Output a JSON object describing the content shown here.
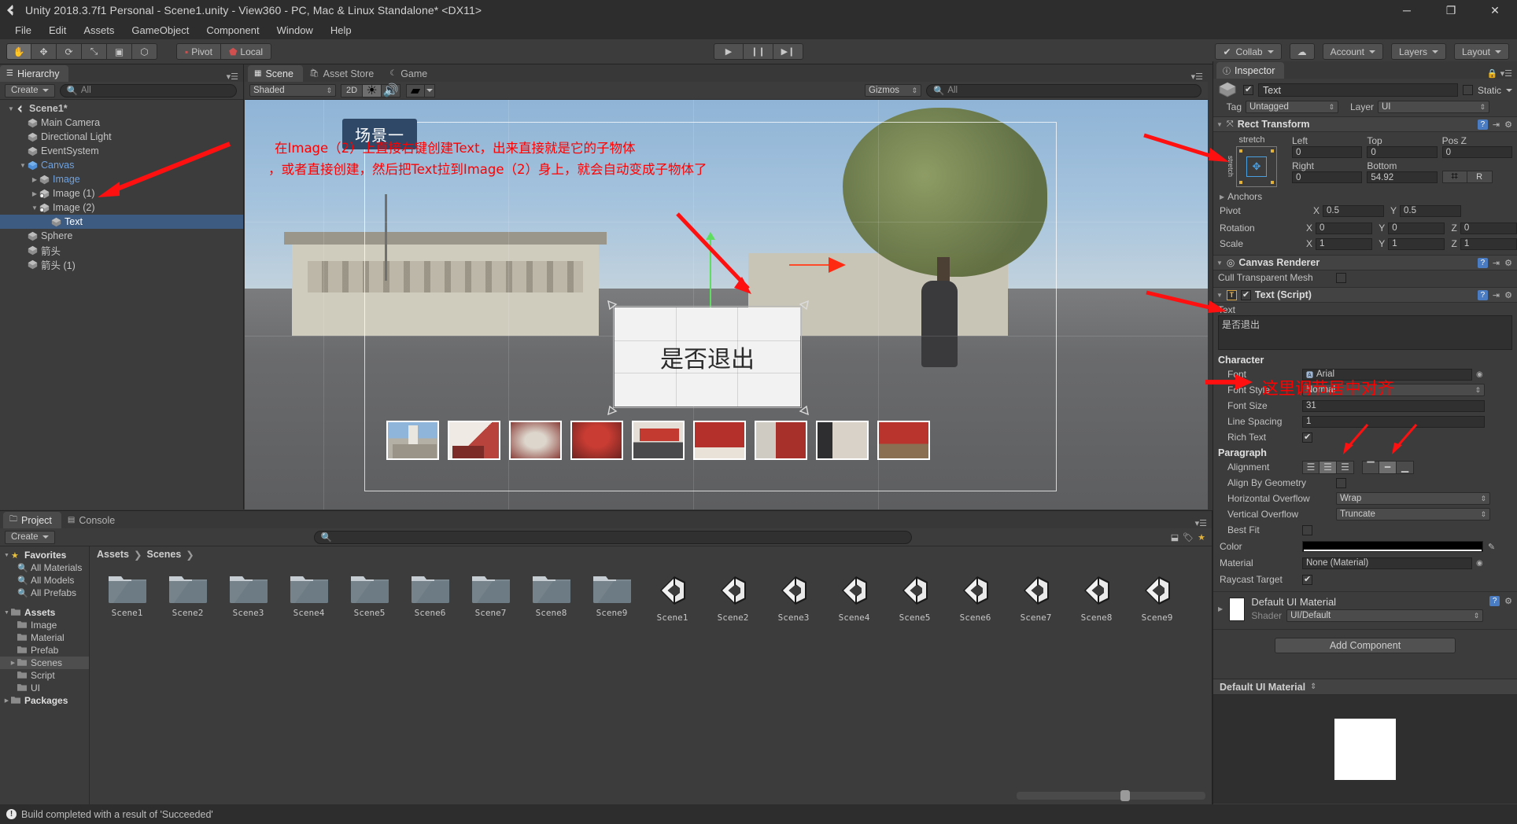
{
  "window": {
    "title": "Unity 2018.3.7f1 Personal - Scene1.unity - View360 - PC, Mac & Linux Standalone* <DX11>",
    "minimize": "─",
    "maximize": "❐",
    "close": "✕"
  },
  "menu": {
    "items": [
      "File",
      "Edit",
      "Assets",
      "GameObject",
      "Component",
      "Window",
      "Help"
    ]
  },
  "toolbar": {
    "tools": [
      "hand-tool",
      "move-tool",
      "rotate-tool",
      "scale-tool",
      "rect-tool",
      "transform-tool"
    ],
    "pivot_label": "Pivot",
    "local_label": "Local",
    "play": "▶",
    "pause": "❙❙",
    "step": "▶❙",
    "collab": "Collab",
    "cloud": "cloud-icon",
    "account": "Account",
    "layers": "Layers",
    "layout": "Layout"
  },
  "hierarchy": {
    "tab": "Hierarchy",
    "create": "Create",
    "search_placeholder": "All",
    "items": [
      {
        "label": "Scene1*",
        "depth": 0,
        "icon": "unity-scene-icon",
        "arrow": "down",
        "selected": false,
        "bold": true
      },
      {
        "label": "Main Camera",
        "depth": 1,
        "icon": "cube-icon",
        "arrow": "none",
        "selected": false,
        "bold": false
      },
      {
        "label": "Directional Light",
        "depth": 1,
        "icon": "cube-icon",
        "arrow": "none",
        "selected": false,
        "bold": false
      },
      {
        "label": "EventSystem",
        "depth": 1,
        "icon": "cube-icon",
        "arrow": "none",
        "selected": false,
        "bold": false
      },
      {
        "label": "Canvas",
        "depth": 1,
        "icon": "canvas-icon",
        "arrow": "down",
        "selected": false,
        "bold": false,
        "blue": true
      },
      {
        "label": "Image",
        "depth": 2,
        "icon": "cube-icon",
        "arrow": "right",
        "selected": false,
        "bold": false,
        "blue": true
      },
      {
        "label": "Image (1)",
        "depth": 2,
        "icon": "prefab-icon",
        "arrow": "right",
        "selected": false,
        "bold": false
      },
      {
        "label": "Image (2)",
        "depth": 2,
        "icon": "prefab-icon",
        "arrow": "down",
        "selected": false,
        "bold": false
      },
      {
        "label": "Text",
        "depth": 3,
        "icon": "cube-icon",
        "arrow": "none",
        "selected": true,
        "bold": false
      },
      {
        "label": "Sphere",
        "depth": 1,
        "icon": "cube-icon",
        "arrow": "none",
        "selected": false,
        "bold": false
      },
      {
        "label": "箭头",
        "depth": 1,
        "icon": "cube-icon",
        "arrow": "none",
        "selected": false,
        "bold": false
      },
      {
        "label": "箭头 (1)",
        "depth": 1,
        "icon": "cube-icon",
        "arrow": "none",
        "selected": false,
        "bold": false
      }
    ]
  },
  "scene": {
    "tabs": [
      {
        "label": "Scene",
        "icon": "grid-icon",
        "active": true
      },
      {
        "label": "Asset Store",
        "icon": "store-icon",
        "active": false
      },
      {
        "label": "Game",
        "icon": "moon-icon",
        "active": false
      }
    ],
    "shading_mode": "Shaded",
    "mode_2d": "2D",
    "light_toggle": "light-icon",
    "audio_toggle": "audio-icon",
    "fx_toggle": "fx-icon",
    "gizmos": "Gizmos",
    "search_placeholder": "All",
    "scene_label": "场景一",
    "ui_text_box": "是否退出",
    "annotation_line1": "在Image（2）上直接右键创建Text，出来直接就是它的子物体",
    "annotation_line2": "，或者直接创建，然后把Text拉到Image（2）身上，就会自动变成子物体了",
    "thumbnail_count": 9
  },
  "inspector": {
    "tab": "Inspector",
    "object_name": "Text",
    "object_enabled": true,
    "static_label": "Static",
    "tag_label": "Tag",
    "tag_value": "Untagged",
    "layer_label": "Layer",
    "layer_value": "UI",
    "rect_transform": {
      "title": "Rect Transform",
      "anchor_preset": "stretch",
      "stretch_side": "stretch",
      "fields": [
        {
          "label": "Left",
          "value": "0"
        },
        {
          "label": "Top",
          "value": "0"
        },
        {
          "label": "Pos Z",
          "value": "0"
        },
        {
          "label": "Right",
          "value": "0"
        },
        {
          "label": "Bottom",
          "value": "54.92"
        }
      ],
      "blueprint_btn": "blueprint-icon",
      "raw_btn": "R",
      "anchors_label": "Anchors",
      "pivot_label": "Pivot",
      "pivot_x": "0.5",
      "pivot_y": "0.5",
      "rotation_label": "Rotation",
      "rotation_x": "0",
      "rotation_y": "0",
      "rotation_z": "0",
      "scale_label": "Scale",
      "scale_x": "1",
      "scale_y": "1",
      "scale_z": "1"
    },
    "canvas_renderer": {
      "title": "Canvas Renderer",
      "cull_label": "Cull Transparent Mesh",
      "cull_checked": false
    },
    "text_script": {
      "title": "Text (Script)",
      "enabled": true,
      "text_label": "Text",
      "text_value": "是否退出",
      "character_header": "Character",
      "font_label": "Font",
      "font_value": "Arial",
      "font_style_label": "Font Style",
      "font_style_value": "Normal",
      "font_size_label": "Font Size",
      "font_size_value": "31",
      "line_spacing_label": "Line Spacing",
      "line_spacing_value": "1",
      "rich_text_label": "Rich Text",
      "rich_text_checked": true,
      "paragraph_header": "Paragraph",
      "alignment_label": "Alignment",
      "align_h_selected": 1,
      "align_v_selected": 1,
      "align_by_geometry_label": "Align By Geometry",
      "align_by_geometry_checked": false,
      "horizontal_overflow_label": "Horizontal Overflow",
      "horizontal_overflow_value": "Wrap",
      "vertical_overflow_label": "Vertical Overflow",
      "vertical_overflow_value": "Truncate",
      "best_fit_label": "Best Fit",
      "best_fit_checked": false,
      "color_label": "Color",
      "color_value": "#000000",
      "material_label": "Material",
      "material_value": "None (Material)",
      "raycast_target_label": "Raycast Target",
      "raycast_target_checked": true
    },
    "material_section": {
      "title": "Default UI Material",
      "shader_label": "Shader",
      "shader_value": "UI/Default"
    },
    "add_component": "Add Component",
    "footer_title": "Default UI Material",
    "annotation": "这里调节居中对齐"
  },
  "project": {
    "tabs": [
      {
        "label": "Project",
        "icon": "folder-icon",
        "active": true
      },
      {
        "label": "Console",
        "icon": "console-icon",
        "active": false
      }
    ],
    "create": "Create",
    "search_placeholder": "",
    "favorites_label": "Favorites",
    "favorites": [
      "All Materials",
      "All Models",
      "All Prefabs"
    ],
    "assets_label": "Assets",
    "assets_children": [
      "Image",
      "Material",
      "Prefab",
      "Scenes",
      "Script",
      "UI"
    ],
    "selected_folder": "Scenes",
    "packages_label": "Packages",
    "breadcrumb": [
      "Assets",
      "Scenes"
    ],
    "items": [
      {
        "name": "Scene1",
        "type": "folder"
      },
      {
        "name": "Scene2",
        "type": "folder"
      },
      {
        "name": "Scene3",
        "type": "folder"
      },
      {
        "name": "Scene4",
        "type": "folder"
      },
      {
        "name": "Scene5",
        "type": "folder"
      },
      {
        "name": "Scene6",
        "type": "folder"
      },
      {
        "name": "Scene7",
        "type": "folder"
      },
      {
        "name": "Scene8",
        "type": "folder"
      },
      {
        "name": "Scene9",
        "type": "folder"
      },
      {
        "name": "Scene1",
        "type": "unity-scene"
      },
      {
        "name": "Scene2",
        "type": "unity-scene"
      },
      {
        "name": "Scene3",
        "type": "unity-scene"
      },
      {
        "name": "Scene4",
        "type": "unity-scene"
      },
      {
        "name": "Scene5",
        "type": "unity-scene"
      },
      {
        "name": "Scene6",
        "type": "unity-scene"
      },
      {
        "name": "Scene7",
        "type": "unity-scene"
      },
      {
        "name": "Scene8",
        "type": "unity-scene"
      },
      {
        "name": "Scene9",
        "type": "unity-scene"
      }
    ]
  },
  "status": {
    "message": "Build completed with a result of 'Succeeded'"
  },
  "colors": {
    "accent": "#3d5a80",
    "annotation": "#ff0000",
    "panel": "#3c3c3c",
    "selected": "#4e4e4e"
  }
}
